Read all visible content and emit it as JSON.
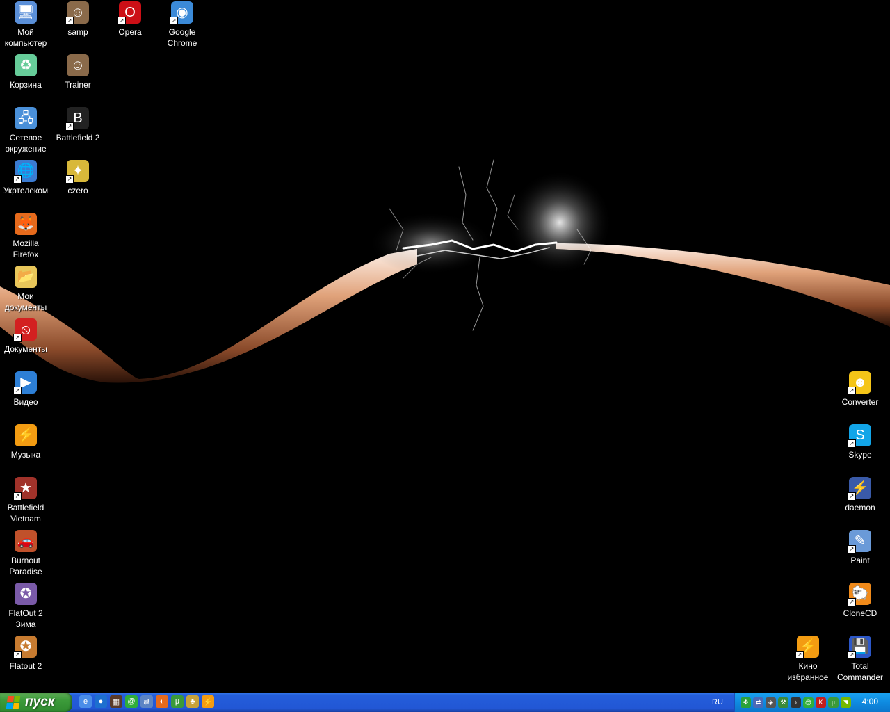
{
  "desktop": {
    "icons_left": [
      {
        "label": "Мой\nкомпьютер",
        "icon": "my-computer-icon",
        "color": "#5a8fd8",
        "glyph": "🖥"
      },
      {
        "label": "Корзина",
        "icon": "recycle-bin-icon",
        "color": "#6c9",
        "glyph": "♻"
      },
      {
        "label": "Сетевое\nокружение",
        "icon": "network-places-icon",
        "color": "#4a90d9",
        "glyph": "🖧"
      },
      {
        "label": "Укртелеком",
        "icon": "ukrtelecom-icon",
        "color": "#3b7bd1",
        "glyph": "🌐",
        "shortcut": true
      },
      {
        "label": "Mozilla\nFirefox",
        "icon": "firefox-icon",
        "color": "#e66a1c",
        "glyph": "🦊"
      },
      {
        "label": "Мои\nдокументы",
        "icon": "my-documents-icon",
        "color": "#e8c65a",
        "glyph": "📂"
      },
      {
        "label": "Документы",
        "icon": "documents-icon",
        "color": "#d32020",
        "glyph": "⦸",
        "shortcut": true
      },
      {
        "label": "Видео",
        "icon": "video-icon",
        "color": "#2d7fd6",
        "glyph": "▶",
        "shortcut": true
      },
      {
        "label": "Музыка",
        "icon": "music-icon",
        "color": "#f39c12",
        "glyph": "⚡"
      },
      {
        "label": "Battlefield\nVietnam",
        "icon": "battlefield-vietnam-icon",
        "color": "#a0322a",
        "glyph": "★",
        "shortcut": true
      },
      {
        "label": "Burnout\nParadise",
        "icon": "burnout-paradise-icon",
        "color": "#c0512b",
        "glyph": "🚗"
      },
      {
        "label": "FlatOut 2\nЗима",
        "icon": "flatout2-winter-icon",
        "color": "#7a5aa8",
        "glyph": "✪"
      },
      {
        "label": "Flatout 2",
        "icon": "flatout2-icon",
        "color": "#c77b30",
        "glyph": "✪",
        "shortcut": true
      }
    ],
    "icons_col2": [
      {
        "label": "samp",
        "icon": "samp-icon",
        "color": "#8a6a4a",
        "glyph": "☺",
        "shortcut": true
      },
      {
        "label": "Trainer",
        "icon": "trainer-icon",
        "color": "#8a6a4a",
        "glyph": "☺"
      },
      {
        "label": "Battlefield 2",
        "icon": "battlefield2-icon",
        "color": "#222",
        "glyph": "B",
        "shortcut": true
      },
      {
        "label": "czero",
        "icon": "czero-icon",
        "color": "#d8b83a",
        "glyph": "✦",
        "shortcut": true
      }
    ],
    "icons_top": [
      {
        "label": "Opera",
        "icon": "opera-icon",
        "color": "#cc0f16",
        "glyph": "O",
        "shortcut": true
      },
      {
        "label": "Google\nChrome",
        "icon": "google-chrome-icon",
        "color": "#3b8ad8",
        "glyph": "◉",
        "shortcut": true
      }
    ],
    "icons_right": [
      {
        "label": "Converter",
        "icon": "converter-icon",
        "color": "#f5c518",
        "glyph": "☻",
        "shortcut": true
      },
      {
        "label": "Skype",
        "icon": "skype-icon",
        "color": "#12a5e8",
        "glyph": "S",
        "shortcut": true
      },
      {
        "label": "daemon",
        "icon": "daemon-tools-icon",
        "color": "#3a5aa8",
        "glyph": "⚡",
        "shortcut": true
      },
      {
        "label": "Paint",
        "icon": "paint-icon",
        "color": "#6a9ad8",
        "glyph": "✎",
        "shortcut": true
      },
      {
        "label": "CloneCD",
        "icon": "clonecd-icon",
        "color": "#f08a1a",
        "glyph": "🐑",
        "shortcut": true
      },
      {
        "label": "Total\nCommander",
        "icon": "total-commander-icon",
        "color": "#2c57c8",
        "glyph": "💾",
        "shortcut": true
      }
    ],
    "icons_bottom_right": [
      {
        "label": "Кино\nизбранное",
        "icon": "cinema-favorites-icon",
        "color": "#f39c12",
        "glyph": "⚡",
        "shortcut": true
      }
    ]
  },
  "taskbar": {
    "start_label": "пуск",
    "quicklaunch": [
      {
        "icon": "show-desktop-icon",
        "color": "#4a8de8",
        "glyph": "e"
      },
      {
        "icon": "globe-icon",
        "color": "#1d6fcf",
        "glyph": "●"
      },
      {
        "icon": "media-icon",
        "color": "#5a3a2a",
        "glyph": "▦"
      },
      {
        "icon": "icq-icon",
        "color": "#2fae3a",
        "glyph": "@"
      },
      {
        "icon": "network-icon",
        "color": "#5b84c4",
        "glyph": "⇄"
      },
      {
        "icon": "firefox-ql-icon",
        "color": "#e66a1c",
        "glyph": "◐"
      },
      {
        "icon": "utorrent-icon",
        "color": "#3a9a3a",
        "glyph": "µ"
      },
      {
        "icon": "tool-icon",
        "color": "#c8a23a",
        "glyph": "♣"
      },
      {
        "icon": "winamp-icon",
        "color": "#f39c12",
        "glyph": "⚡"
      }
    ],
    "language": "RU",
    "tray": [
      {
        "icon": "tray-clover-icon",
        "color": "#2aa23a",
        "glyph": "✤"
      },
      {
        "icon": "tray-network-icon",
        "color": "#4a6ab8",
        "glyph": "⇄"
      },
      {
        "icon": "tray-shield-icon",
        "color": "#555",
        "glyph": "◈"
      },
      {
        "icon": "tray-tool-icon",
        "color": "#3a8a3a",
        "glyph": "⚒"
      },
      {
        "icon": "tray-volume-icon",
        "color": "#333",
        "glyph": "♪"
      },
      {
        "icon": "tray-icq-icon",
        "color": "#2fae3a",
        "glyph": "@"
      },
      {
        "icon": "tray-kaspersky-icon",
        "color": "#c41e1e",
        "glyph": "K"
      },
      {
        "icon": "tray-utorrent-icon",
        "color": "#3a9a3a",
        "glyph": "µ"
      },
      {
        "icon": "tray-nvidia-icon",
        "color": "#76b900",
        "glyph": "◥"
      }
    ],
    "clock": "4:00"
  }
}
